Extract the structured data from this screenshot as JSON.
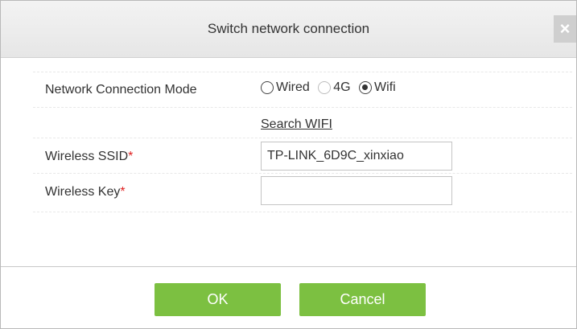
{
  "dialog": {
    "title": "Switch network connection",
    "close_label": "×"
  },
  "form": {
    "network_mode": {
      "label": "Network Connection Mode",
      "options": [
        {
          "label": "Wired",
          "checked": false
        },
        {
          "label": "4G",
          "checked": false
        },
        {
          "label": "Wifi",
          "checked": true
        }
      ]
    },
    "search_wifi_link": "Search WIFI",
    "wireless_ssid": {
      "label": "Wireless SSID",
      "required_mark": "*",
      "value": "TP-LINK_6D9C_xinxiao"
    },
    "wireless_key": {
      "label": "Wireless Key",
      "required_mark": "*",
      "value": ""
    }
  },
  "footer": {
    "ok_label": "OK",
    "cancel_label": "Cancel"
  },
  "colors": {
    "button_green": "#7cc041",
    "required_red": "#e02020"
  }
}
